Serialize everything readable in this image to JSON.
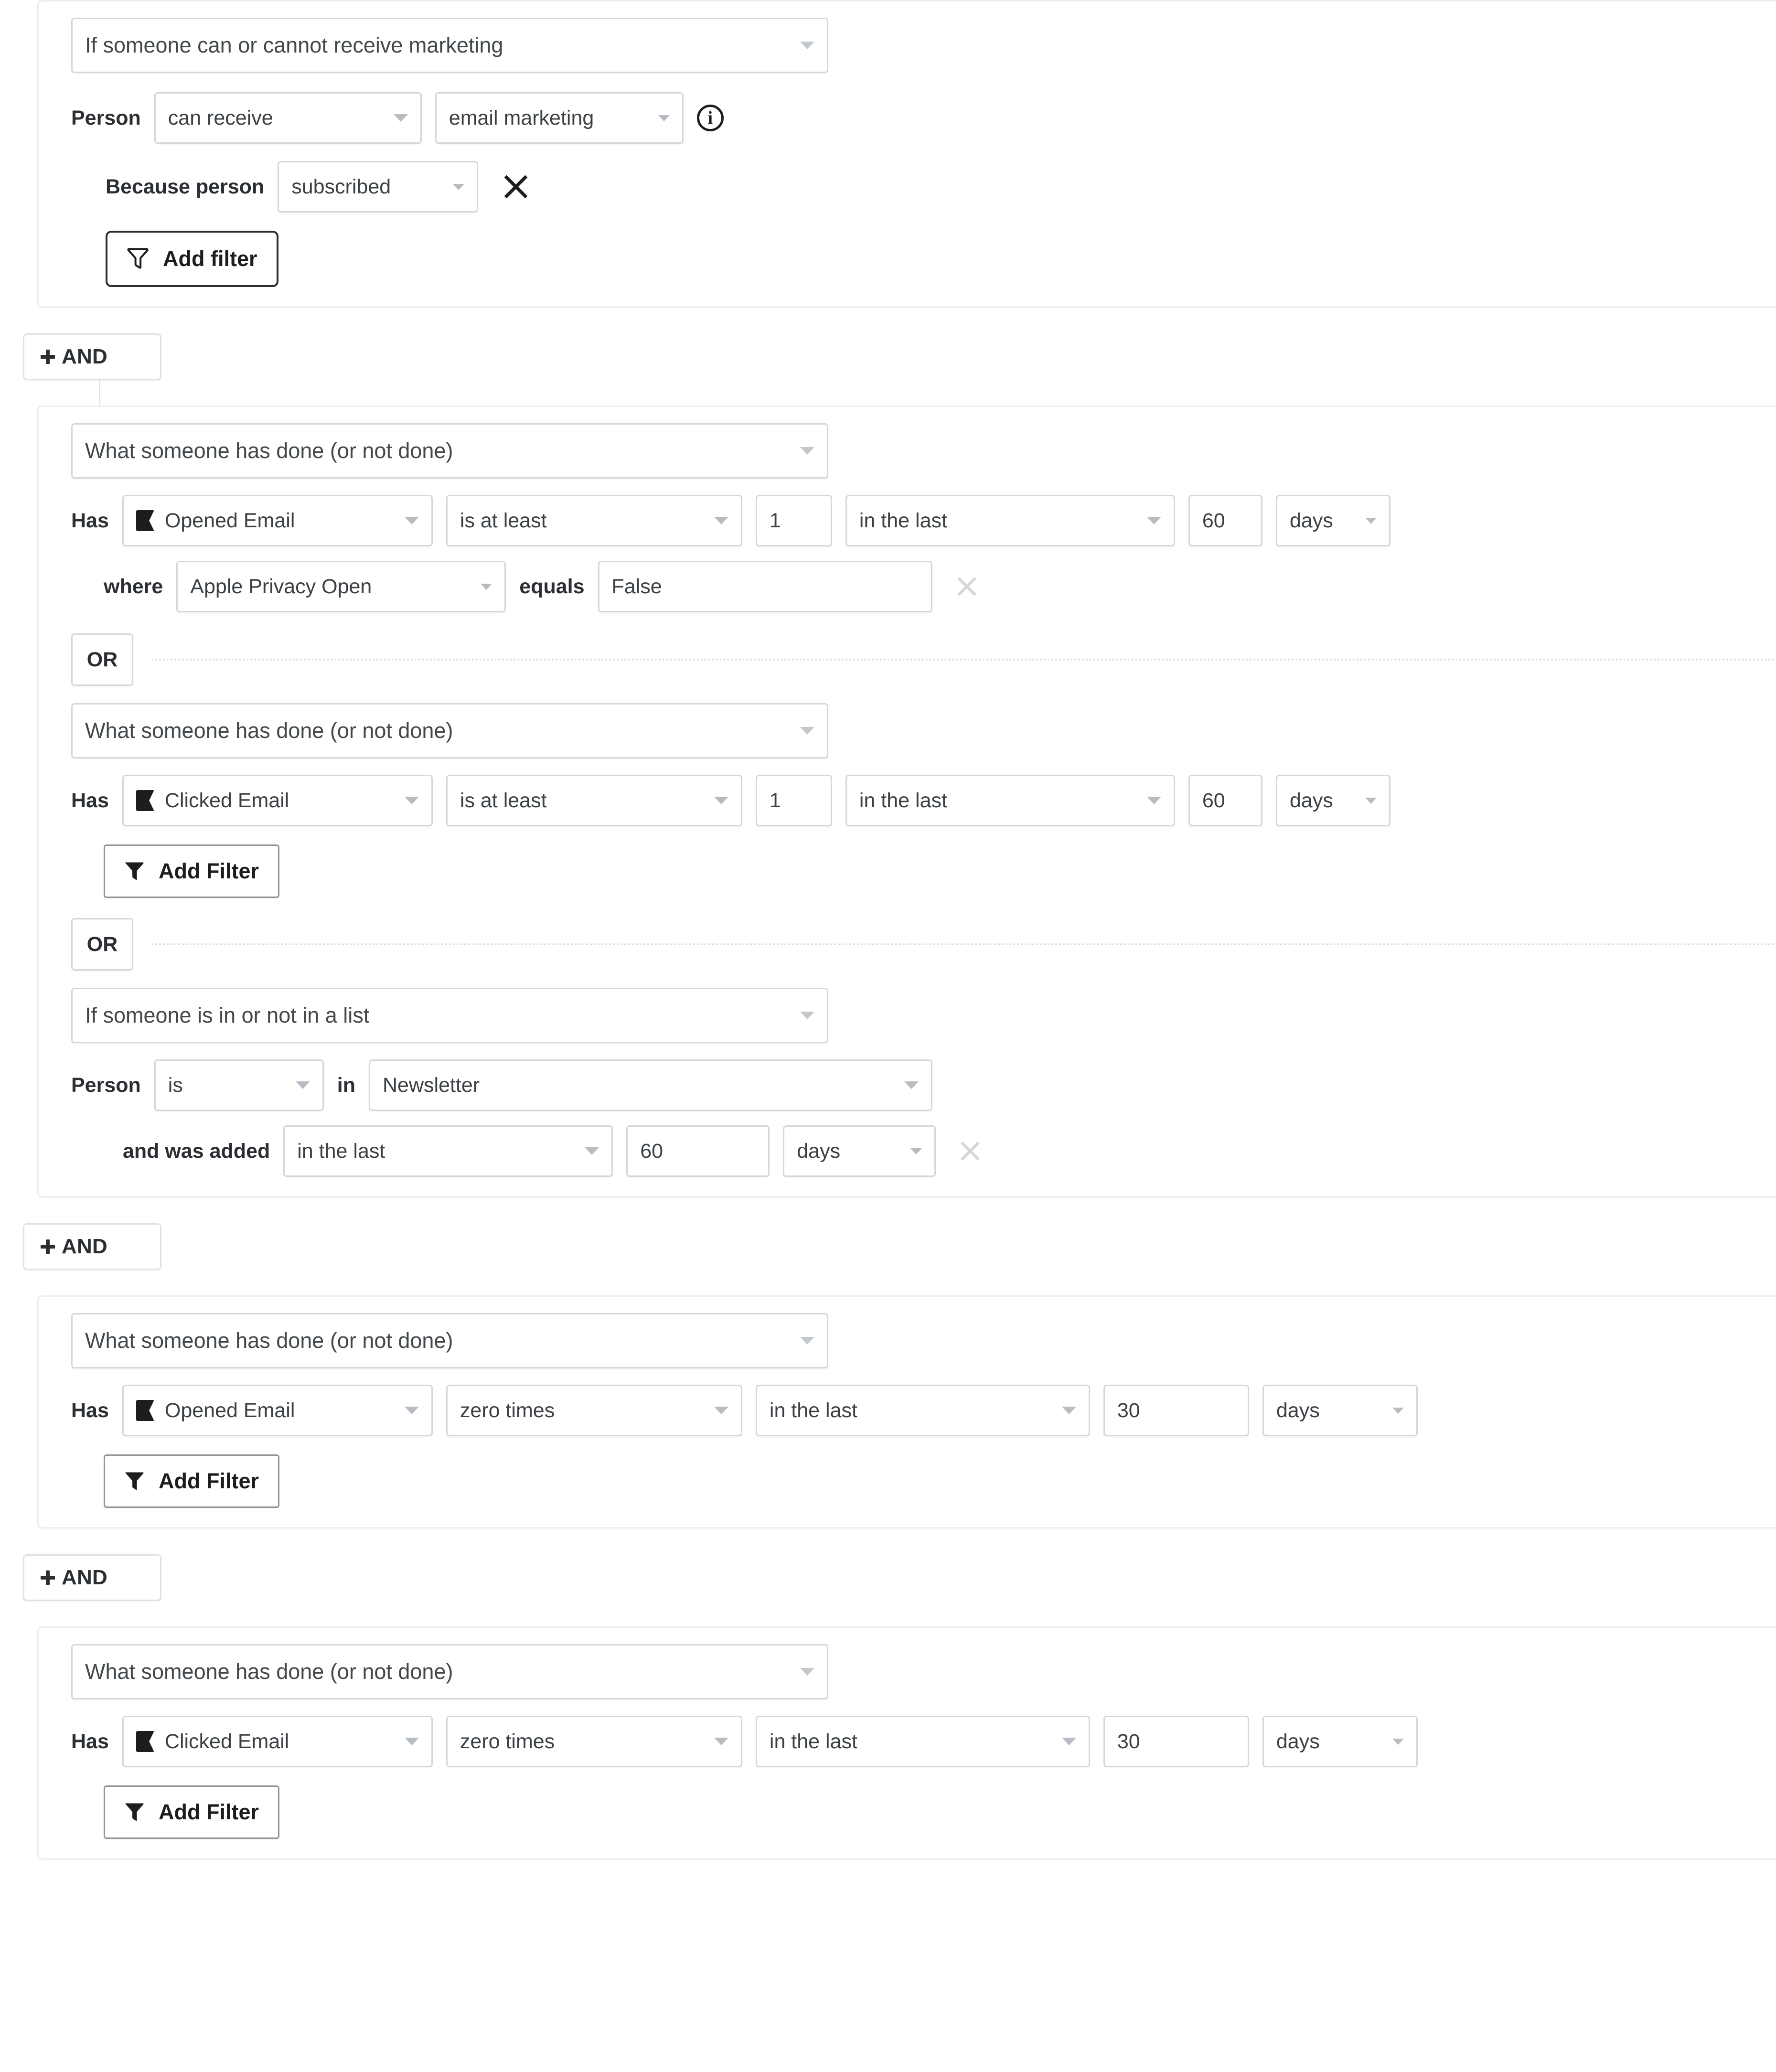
{
  "builder": {
    "and_label": "AND",
    "or_label": "OR",
    "groups": [
      {
        "id": "group-marketing-consent",
        "type_selector": "If someone can or cannot receive marketing",
        "rows": [
          {
            "kind": "consent",
            "label": "Person",
            "consent_state": "can receive",
            "channel": "email marketing",
            "info_icon": "info-icon"
          },
          {
            "kind": "because",
            "label": "Because person",
            "reason": "subscribed",
            "remove_icon": "close-icon"
          }
        ],
        "add_filter_label": "Add filter",
        "add_filter_icon": "funnel-outline-icon"
      },
      {
        "id": "group-engaged-or",
        "conditions": [
          {
            "type_selector": "What someone has done (or not done)",
            "label": "Has",
            "metric_icon": "flag-icon",
            "metric": "Opened Email",
            "operator": "is at least",
            "count": "1",
            "timeframe": "in the last",
            "number": "60",
            "unit": "days",
            "filter": {
              "where_label": "where",
              "property": "Apple Privacy Open",
              "comparator_label": "equals",
              "value": "False",
              "remove_icon": "close-icon"
            }
          },
          {
            "type_selector": "What someone has done (or not done)",
            "label": "Has",
            "metric_icon": "flag-icon",
            "metric": "Clicked Email",
            "operator": "is at least",
            "count": "1",
            "timeframe": "in the last",
            "number": "60",
            "unit": "days",
            "add_filter_label": "Add Filter",
            "add_filter_icon": "funnel-solid-icon"
          },
          {
            "type_selector": "If someone is in or not in a list",
            "label": "Person",
            "membership": "is",
            "in_label": "in",
            "list": "Newsletter",
            "added_label": "and was added",
            "timeframe": "in the last",
            "number": "60",
            "unit": "days",
            "remove_icon": "close-icon"
          }
        ]
      },
      {
        "id": "group-no-opens",
        "type_selector": "What someone has done (or not done)",
        "label": "Has",
        "metric_icon": "flag-icon",
        "metric": "Opened Email",
        "operator": "zero times",
        "timeframe": "in the last",
        "number": "30",
        "unit": "days",
        "add_filter_label": "Add Filter",
        "add_filter_icon": "funnel-solid-icon"
      },
      {
        "id": "group-no-clicks",
        "type_selector": "What someone has done (or not done)",
        "label": "Has",
        "metric_icon": "flag-icon",
        "metric": "Clicked Email",
        "operator": "zero times",
        "timeframe": "in the last",
        "number": "30",
        "unit": "days",
        "add_filter_label": "Add Filter",
        "add_filter_icon": "funnel-solid-icon"
      }
    ]
  },
  "colors": {
    "card_border": "#eceef0",
    "field_border": "#d5d8db",
    "text": "#2b2f33",
    "muted": "#b6bcc2",
    "accent": "#1b1d1f"
  }
}
